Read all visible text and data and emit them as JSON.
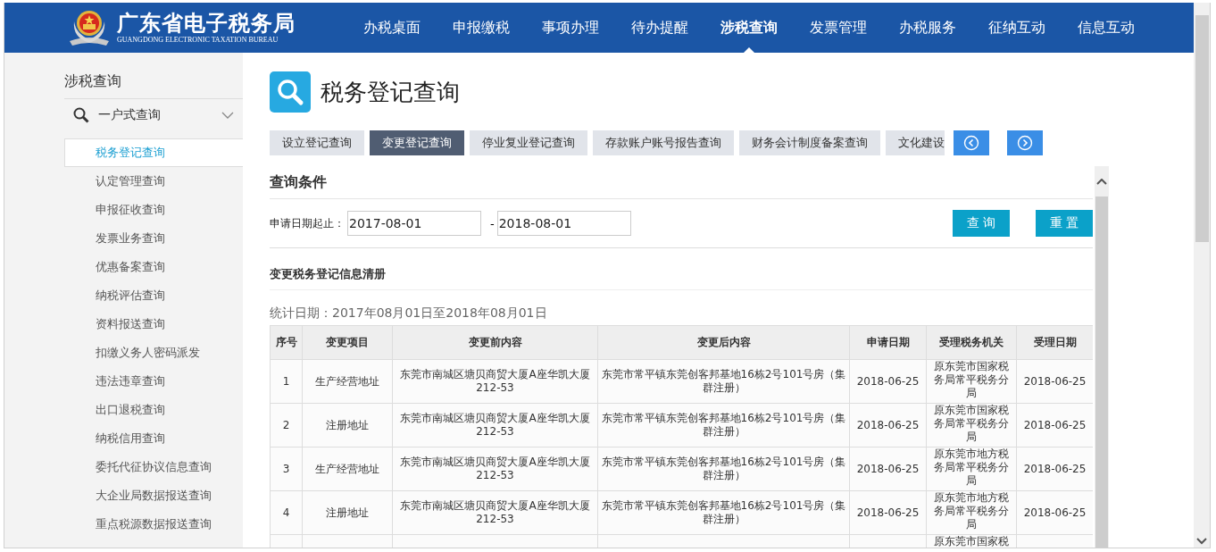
{
  "header": {
    "title": "广东省电子税务局",
    "subtitle": "GUANGDONG ELECTRONIC TAXATION BUREAU",
    "nav": [
      {
        "label": "办税桌面",
        "selected": false
      },
      {
        "label": "申报缴税",
        "selected": false
      },
      {
        "label": "事项办理",
        "selected": false
      },
      {
        "label": "待办提醒",
        "selected": false
      },
      {
        "label": "涉税查询",
        "selected": true
      },
      {
        "label": "发票管理",
        "selected": false
      },
      {
        "label": "办税服务",
        "selected": false
      },
      {
        "label": "征纳互动",
        "selected": false
      },
      {
        "label": "信息互动",
        "selected": false
      }
    ]
  },
  "sidebar": {
    "title": "涉税查询",
    "group": {
      "label": "一户式查询",
      "expanded": true,
      "items": [
        {
          "label": "税务登记查询",
          "selected": true
        },
        {
          "label": "认定管理查询",
          "selected": false
        },
        {
          "label": "申报征收查询",
          "selected": false
        },
        {
          "label": "发票业务查询",
          "selected": false
        },
        {
          "label": "优惠备案查询",
          "selected": false
        },
        {
          "label": "纳税评估查询",
          "selected": false
        },
        {
          "label": "资料报送查询",
          "selected": false
        },
        {
          "label": "扣缴义务人密码派发",
          "selected": false
        },
        {
          "label": "违法违章查询",
          "selected": false
        },
        {
          "label": "出口退税查询",
          "selected": false
        },
        {
          "label": "纳税信用查询",
          "selected": false
        },
        {
          "label": "委托代征协议信息查询",
          "selected": false
        },
        {
          "label": "大企业局数据报送查询",
          "selected": false
        },
        {
          "label": "重点税源数据报送查询",
          "selected": false
        }
      ]
    }
  },
  "page": {
    "title": "税务登记查询",
    "tabs": [
      {
        "label": "设立登记查询",
        "selected": false
      },
      {
        "label": "变更登记查询",
        "selected": true
      },
      {
        "label": "停业复业登记查询",
        "selected": false
      },
      {
        "label": "存款账户账号报告查询",
        "selected": false
      },
      {
        "label": "财务会计制度备案查询",
        "selected": false
      },
      {
        "label": "文化建设",
        "selected": false
      }
    ],
    "filter": {
      "heading": "查询条件",
      "label": "申请日期起止：",
      "start": "2017-08-01",
      "separator": "-",
      "end": "2018-08-01",
      "buttons": [
        "查 询",
        "重 置"
      ]
    },
    "list": {
      "heading": "变更税务登记信息清册",
      "stat": "统计日期：2017年08月01日至2018年08月01日",
      "columns": [
        "序号",
        "变更项目",
        "变更前内容",
        "变更后内容",
        "申请日期",
        "受理税务机关",
        "受理日期"
      ],
      "rows": [
        {
          "no": "1",
          "item": "生产经营地址",
          "before": "东莞市南城区塘贝商贸大厦A座华凯大厦212-53",
          "after": "东莞市常平镇东莞创客邦基地16栋2号101号房（集群注册）",
          "apply_date": "2018-06-25",
          "agency": "原东莞市国家税务局常平税务分局",
          "accept_date": "2018-06-25"
        },
        {
          "no": "2",
          "item": "注册地址",
          "before": "东莞市南城区塘贝商贸大厦A座华凯大厦212-53",
          "after": "东莞市常平镇东莞创客邦基地16栋2号101号房（集群注册）",
          "apply_date": "2018-06-25",
          "agency": "原东莞市国家税务局常平税务分局",
          "accept_date": "2018-06-25"
        },
        {
          "no": "3",
          "item": "生产经营地址",
          "before": "东莞市南城区塘贝商贸大厦A座华凯大厦212-53",
          "after": "东莞市常平镇东莞创客邦基地16栋2号101号房（集群注册）",
          "apply_date": "2018-06-25",
          "agency": "原东莞市地方税务局常平税务分局",
          "accept_date": "2018-06-25"
        },
        {
          "no": "4",
          "item": "注册地址",
          "before": "东莞市南城区塘贝商贸大厦A座华凯大厦212-53",
          "after": "东莞市常平镇东莞创客邦基地16栋2号101号房（集群注册）",
          "apply_date": "2018-06-25",
          "agency": "原东莞市地方税务局常平税务分局",
          "accept_date": "2018-06-25"
        },
        {
          "agency": "原东莞市国家税"
        }
      ]
    }
  }
}
